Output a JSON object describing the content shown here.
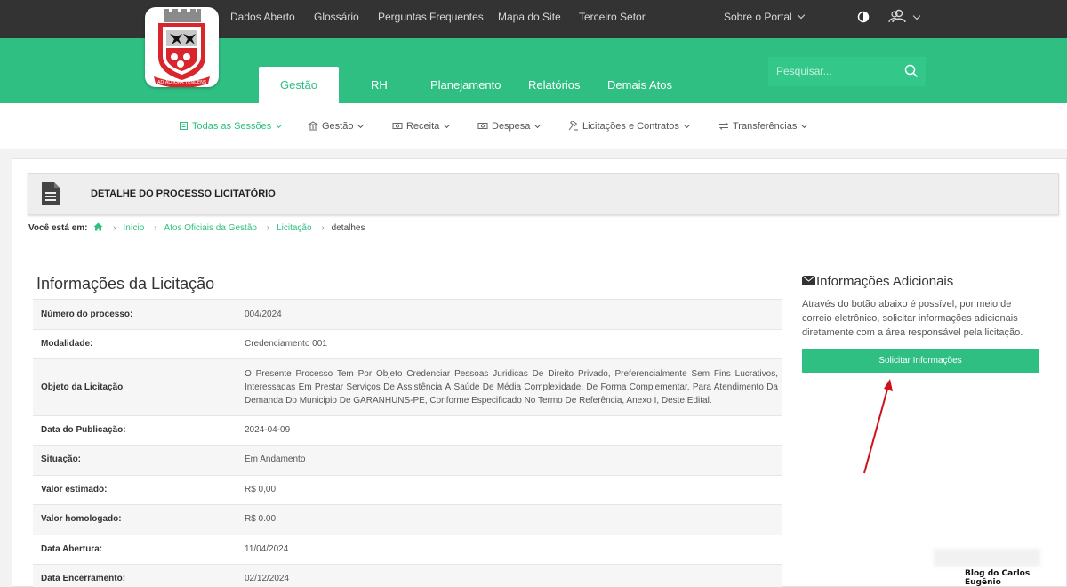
{
  "topnav": {
    "links": [
      "Dados Aberto",
      "Glossário",
      "Perguntas Frequentes",
      "Mapa do Site",
      "Terceiro Setor"
    ],
    "about": "Sobre o Portal"
  },
  "logo": {
    "motto": "AD ALTIORA TENDENS"
  },
  "tabs": [
    "Gestão",
    "RH",
    "Planejamento",
    "Relatórios",
    "Demais Atos"
  ],
  "search": {
    "placeholder": "Pesquisar..."
  },
  "subnav": [
    "Todas as Sessões",
    "Gestão",
    "Receita",
    "Despesa",
    "Licitações e Contratos",
    "Transferências"
  ],
  "page": {
    "title": "DETALHE DO PROCESSO LICITATÓRIO"
  },
  "breadcrumb": {
    "prefix": "Você está em:",
    "items": [
      "Início",
      "Atos Oficiais da Gestão",
      "Licitação"
    ],
    "current": "detalhes"
  },
  "info": {
    "heading": "Informações da Licitação",
    "rows": [
      {
        "label": "Número do processo:",
        "value": "004/2024"
      },
      {
        "label": "Modalidade:",
        "value": "Credenciamento  001"
      },
      {
        "label": "Objeto da Licitação",
        "value": "O Presente Processo Tem Por Objeto Credenciar Pessoas Juridicas De Direito Privado, Preferencialmente Sem Fins Lucrativos, Interessadas Em Prestar Serviços De Assistência À Saúde De Média Complexidade, De Forma Complementar, Para Atendimento Da Demanda Do Municipio De GARANHUNS-PE, Conforme Especificado No Termo De Referência, Anexo I, Deste Edital."
      },
      {
        "label": "Data do Publicação:",
        "value": "2024-04-09"
      },
      {
        "label": "Situação:",
        "value": "Em Andamento"
      },
      {
        "label": "Valor estimado:",
        "value": "R$ 0,00"
      },
      {
        "label": "Valor homologado:",
        "value": "R$ 0.00"
      },
      {
        "label": "Data Abertura:",
        "value": "11/04/2024"
      },
      {
        "label": "Data Encerramento:",
        "value": "02/12/2024"
      }
    ]
  },
  "additional": {
    "heading": "Informações Adicionais",
    "text": "Através do botão abaixo é possível, por meio de correio eletrônico, solicitar informações adicionais diretamente com a área responsável pela licitação.",
    "button": "Solicitar Informações"
  },
  "watermark": "Blog do Carlos Eugênio",
  "colors": {
    "brand": "#2fbf83",
    "topbar": "#333333",
    "arrow": "#d0101a"
  }
}
